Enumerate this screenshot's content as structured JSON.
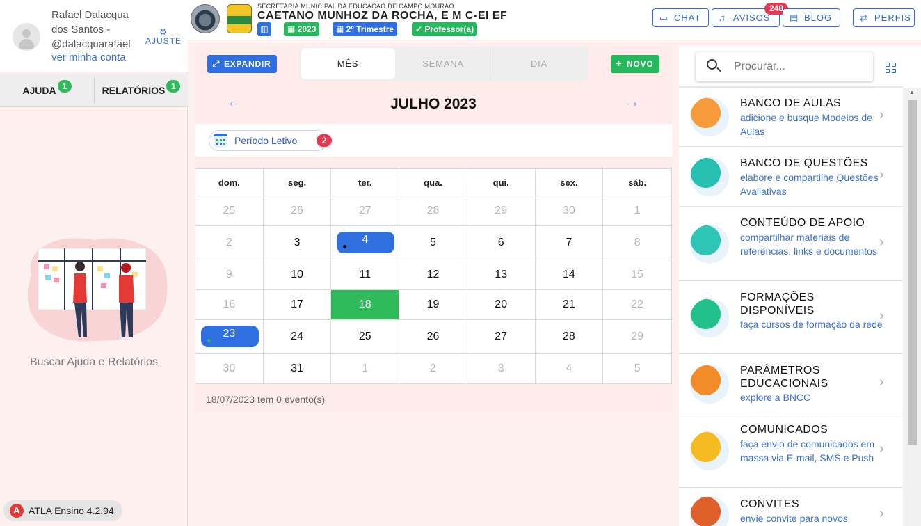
{
  "user": {
    "name": "Rafael Dalacqua dos Santos - @dalacquarafael",
    "account_link": "ver minha conta",
    "settings_label": "AJUSTE"
  },
  "help_tabs": [
    {
      "label": "AJUDA",
      "count": "1"
    },
    {
      "label": "RELATÓRIOS",
      "count": "1"
    }
  ],
  "help_caption": "Buscar Ajuda e Relatórios",
  "version": "ATLA Ensino 4.2.94",
  "header": {
    "secretaria": "SECRETARIA MUNICIPAL DA EDUCAÇÃO DE CAMPO MOURÃO",
    "school": "CAETANO MUNHOZ DA ROCHA, E M C-EI EF",
    "year": "2023",
    "term": "2º Trimestre",
    "role": "Professor(a)",
    "buttons": {
      "chat": "CHAT",
      "avisos": "AVISOS",
      "avisos_count": "248",
      "blog": "BLOG",
      "perfis": "PERFIS"
    }
  },
  "calendar": {
    "expand_label": "EXPANDIR",
    "new_label": "NOVO",
    "tabs": [
      "MÊS",
      "SEMANA",
      "DIA"
    ],
    "month_title": "JULHO 2023",
    "periodo_label": "Período Letivo",
    "periodo_count": "2",
    "weekdays": [
      "dom.",
      "seg.",
      "ter.",
      "qua.",
      "qui.",
      "sex.",
      "sáb."
    ],
    "weeks": [
      [
        "25",
        "26",
        "27",
        "28",
        "29",
        "30",
        "1"
      ],
      [
        "2",
        "3",
        "4",
        "5",
        "6",
        "7",
        "8"
      ],
      [
        "9",
        "10",
        "11",
        "12",
        "13",
        "14",
        "15"
      ],
      [
        "16",
        "17",
        "18",
        "19",
        "20",
        "21",
        "22"
      ],
      [
        "23",
        "24",
        "25",
        "26",
        "27",
        "28",
        "29"
      ],
      [
        "30",
        "31",
        "1",
        "2",
        "3",
        "4",
        "5"
      ]
    ],
    "events_note": "18/07/2023 tem 0 evento(s)"
  },
  "search": {
    "placeholder": "Procurar..."
  },
  "resources": [
    {
      "title": "BANCO DE AULAS",
      "desc": "adicione e busque Modelos de Aulas",
      "icon": "lesson-bank-icon",
      "color": "#f59b3c"
    },
    {
      "title": "BANCO DE QUESTÕES",
      "desc": "elabore e compartilhe Questões Avaliativas",
      "icon": "question-bank-icon",
      "color": "#27c0b0"
    },
    {
      "title": "CONTEÚDO DE APOIO",
      "desc": "compartilhar materiais de referências, links e documentos",
      "icon": "support-content-icon",
      "color": "#2ec4b6"
    },
    {
      "title": "FORMAÇÕES DISPONÍVEIS",
      "desc": "faça cursos de formação da rede",
      "icon": "training-icon",
      "color": "#22c08a"
    },
    {
      "title": "PARÂMETROS EDUCACIONAIS",
      "desc": "explore a BNCC",
      "icon": "parameters-icon",
      "color": "#f28c28"
    },
    {
      "title": "COMUNICADOS",
      "desc": "faça envio de comunicados em massa via E-mail, SMS e Push",
      "icon": "announcements-icon",
      "color": "#f5b921"
    },
    {
      "title": "CONVITES",
      "desc": "envie convite para novos",
      "icon": "invites-icon",
      "color": "#e0602b"
    }
  ]
}
